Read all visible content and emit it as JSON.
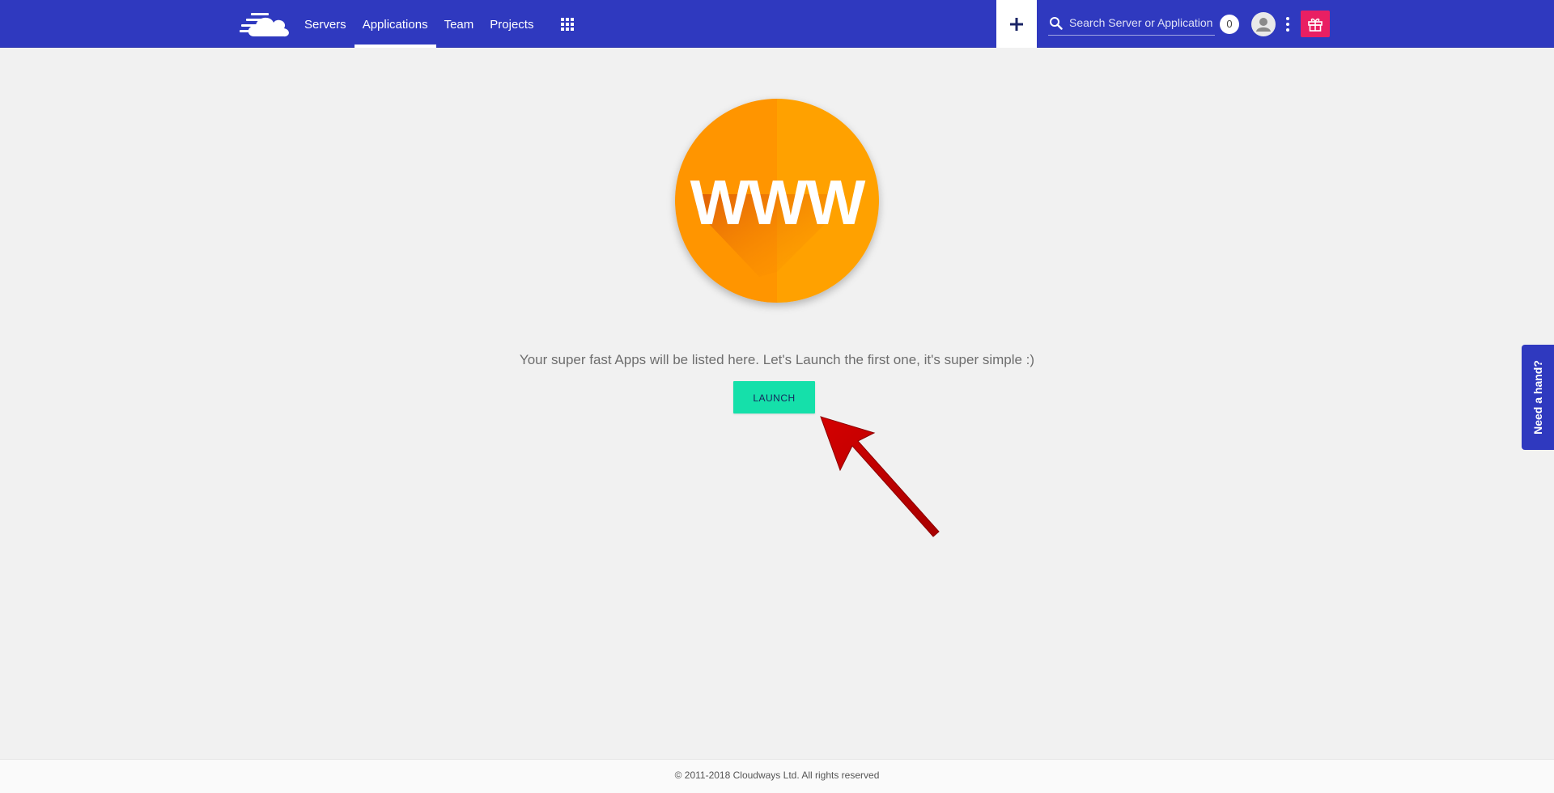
{
  "colors": {
    "topbar": "#2f39bf",
    "launch_button": "#15e0aa",
    "gift_button": "#e91f63",
    "illustration": "#ff9800",
    "arrow": "#cc0000"
  },
  "header": {
    "logo_icon": "cloudways-cloud-icon",
    "nav": [
      {
        "label": "Servers",
        "active": false
      },
      {
        "label": "Applications",
        "active": true
      },
      {
        "label": "Team",
        "active": false
      },
      {
        "label": "Projects",
        "active": false
      }
    ],
    "apps_grid_icon": "grid-icon",
    "add_icon": "plus-icon",
    "search": {
      "placeholder": "Search Server or Application",
      "value": "",
      "icon": "search-icon"
    },
    "notifications_count": "0",
    "avatar_icon": "user-icon",
    "more_icon": "kebab-icon",
    "gift_icon": "gift-icon"
  },
  "main": {
    "illustration_text": "WWW",
    "empty_message": "Your super fast Apps will be listed here. Let's Launch the first one, it's super simple :)",
    "launch_button": "LAUNCH"
  },
  "help_tab": {
    "label": "Need a hand?"
  },
  "footer": {
    "text": "© 2011-2018 Cloudways Ltd. All rights reserved"
  }
}
